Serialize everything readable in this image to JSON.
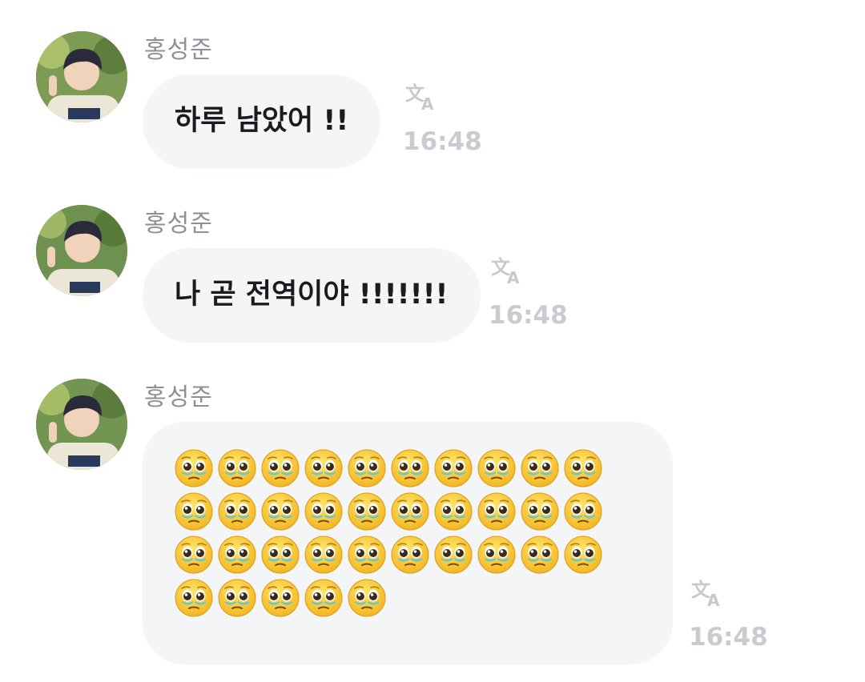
{
  "messages": [
    {
      "sender": "홍성준",
      "text": "하루 남았어 !!",
      "time": "16:48",
      "translate_icon": "translate-icon"
    },
    {
      "sender": "홍성준",
      "text": "나 곧 전역이야 !!!!!!!",
      "time": "16:48",
      "translate_icon": "translate-icon"
    },
    {
      "sender": "홍성준",
      "emoji": "pleading-face-emoji",
      "emoji_count": 35,
      "time": "16:48",
      "translate_icon": "translate-icon"
    }
  ],
  "colors": {
    "bubble": "#f4f5f7",
    "sender": "#8e9098",
    "time": "#c9cbd1",
    "text": "#1a1b1f"
  }
}
